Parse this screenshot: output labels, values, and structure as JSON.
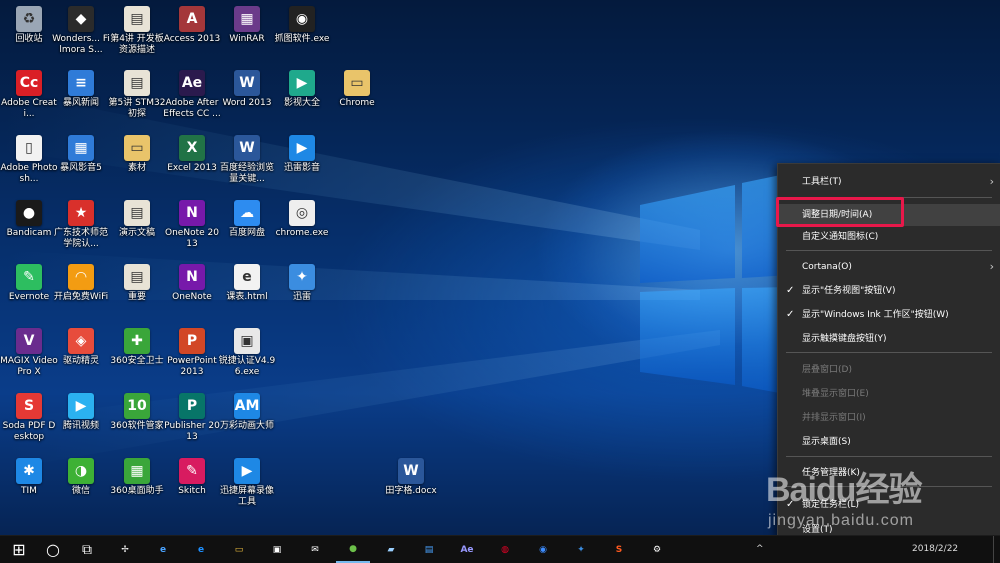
{
  "desktop_icons": [
    {
      "label": "回收站",
      "icon": "recycle-bin-icon",
      "color": "#9aa6b5",
      "glyph": "♻"
    },
    {
      "label": "Wonders... Filmora S...",
      "icon": "filmora-icon",
      "color": "#2b2b2b",
      "glyph": "◆"
    },
    {
      "label": "第4讲 开发板资源描述",
      "icon": "folder-file-icon",
      "color": "#e8e3d6",
      "glyph": "▤"
    },
    {
      "label": "Access 2013",
      "icon": "access-icon",
      "color": "#a4373a",
      "glyph": "A"
    },
    {
      "label": "WinRAR",
      "icon": "winrar-icon",
      "color": "#6b3b8a",
      "glyph": "▦"
    },
    {
      "label": "抓图软件.exe",
      "icon": "camera-icon",
      "color": "#222222",
      "glyph": "◉"
    },
    {
      "label": "Adobe Creati...",
      "icon": "adobe-cc-icon",
      "color": "#da1f26",
      "glyph": "Cc"
    },
    {
      "label": "暴风新闻",
      "icon": "news-icon",
      "color": "#2f7bd8",
      "glyph": "≡"
    },
    {
      "label": "第5讲 STM32初探",
      "icon": "folder-file-icon",
      "color": "#e8e3d6",
      "glyph": "▤"
    },
    {
      "label": "Adobe After Effects CC ...",
      "icon": "after-effects-icon",
      "color": "#2b1a4d",
      "glyph": "Ae"
    },
    {
      "label": "Word 2013",
      "icon": "word-icon",
      "color": "#2b579a",
      "glyph": "W"
    },
    {
      "label": "影视大全",
      "icon": "video-app-icon",
      "color": "#1fa98c",
      "glyph": "▶"
    },
    {
      "label": "Chrome",
      "icon": "folder-icon",
      "color": "#e9c46a",
      "glyph": "▭"
    },
    {
      "label": "Adobe Photosh...",
      "icon": "file-icon",
      "color": "#f2f2f2",
      "glyph": "▯"
    },
    {
      "label": "暴风影音5",
      "icon": "player-icon",
      "color": "#2f7bd8",
      "glyph": "▦"
    },
    {
      "label": "素材",
      "icon": "folder-icon",
      "color": "#e9c46a",
      "glyph": "▭"
    },
    {
      "label": "Excel 2013",
      "icon": "excel-icon",
      "color": "#217346",
      "glyph": "X"
    },
    {
      "label": "百度经验浏览量关键...",
      "icon": "word-icon",
      "color": "#2b579a",
      "glyph": "W"
    },
    {
      "label": "迅雷影音",
      "icon": "xunlei-player-icon",
      "color": "#1e88e5",
      "glyph": "▶"
    },
    {
      "label": "Bandicam",
      "icon": "bandicam-icon",
      "color": "#1a1a1a",
      "glyph": "●"
    },
    {
      "label": "广东技术师范学院认...",
      "icon": "shortcut-icon",
      "color": "#d9302b",
      "glyph": "★"
    },
    {
      "label": "演示文稿",
      "icon": "folder-file-icon",
      "color": "#e8e3d6",
      "glyph": "▤"
    },
    {
      "label": "OneNote 2013",
      "icon": "onenote-icon",
      "color": "#7719aa",
      "glyph": "N"
    },
    {
      "label": "百度网盘",
      "icon": "baidu-netdisk-icon",
      "color": "#2d8cf0",
      "glyph": "☁"
    },
    {
      "label": "chrome.exe",
      "icon": "chrome-icon",
      "color": "#eeeeee",
      "glyph": "◎"
    },
    {
      "label": "Evernote",
      "icon": "evernote-icon",
      "color": "#2dbe60",
      "glyph": "✎"
    },
    {
      "label": "开启免费WiFi",
      "icon": "wifi-icon",
      "color": "#f39c12",
      "glyph": "◠"
    },
    {
      "label": "重要",
      "icon": "folder-file-icon",
      "color": "#e8e3d6",
      "glyph": "▤"
    },
    {
      "label": "OneNote",
      "icon": "onenote-icon",
      "color": "#7719aa",
      "glyph": "N"
    },
    {
      "label": "课表.html",
      "icon": "html-file-icon",
      "color": "#f2f2f2",
      "glyph": "e"
    },
    {
      "label": "迅雷",
      "icon": "xunlei-icon",
      "color": "#3b8de0",
      "glyph": "✦"
    },
    {
      "label": "MAGIX Video Pro X",
      "icon": "magix-icon",
      "color": "#6a2c8e",
      "glyph": "V"
    },
    {
      "label": "驱动精灵",
      "icon": "driver-icon",
      "color": "#e74c3c",
      "glyph": "◈"
    },
    {
      "label": "360安全卫士",
      "icon": "360-security-icon",
      "color": "#3aa63a",
      "glyph": "✚"
    },
    {
      "label": "PowerPoint 2013",
      "icon": "powerpoint-icon",
      "color": "#d24726",
      "glyph": "P"
    },
    {
      "label": "锐捷认证V4.96.exe",
      "icon": "exe-icon",
      "color": "#e8e8e8",
      "glyph": "▣"
    },
    {
      "label": "Soda PDF Desktop",
      "icon": "soda-pdf-icon",
      "color": "#e53935",
      "glyph": "S"
    },
    {
      "label": "腾讯视频",
      "icon": "tencent-video-icon",
      "color": "#2bb1f0",
      "glyph": "▶"
    },
    {
      "label": "360软件管家",
      "icon": "360-software-icon",
      "color": "#3aa63a",
      "glyph": "10"
    },
    {
      "label": "Publisher 2013",
      "icon": "publisher-icon",
      "color": "#077568",
      "glyph": "P"
    },
    {
      "label": "万彩动画大师",
      "icon": "animation-icon",
      "color": "#1e88e5",
      "glyph": "AM"
    },
    {
      "label": "TIM",
      "icon": "tim-icon",
      "color": "#1e88e5",
      "glyph": "✱"
    },
    {
      "label": "微信",
      "icon": "wechat-icon",
      "color": "#3eb135",
      "glyph": "◑"
    },
    {
      "label": "360桌面助手",
      "icon": "360-desktop-icon",
      "color": "#3aa63a",
      "glyph": "▦"
    },
    {
      "label": "Skitch",
      "icon": "skitch-icon",
      "color": "#d81b60",
      "glyph": "✎"
    },
    {
      "label": "迅捷屏幕录像工具",
      "icon": "screen-recorder-icon",
      "color": "#1e88e5",
      "glyph": "▶"
    },
    {
      "label": "田字格.docx",
      "icon": "word-icon",
      "color": "#2b579a",
      "glyph": "W"
    }
  ],
  "context_menu": {
    "items": [
      {
        "label": "工具栏(T)",
        "submenu": true
      },
      {
        "label": "调整日期/时间(A)",
        "highlight": true
      },
      {
        "label": "自定义通知图标(C)"
      },
      {
        "label": "Cortana(O)",
        "submenu": true
      },
      {
        "label": "显示\"任务视图\"按钮(V)",
        "checked": true
      },
      {
        "label": "显示\"Windows Ink 工作区\"按钮(W)",
        "checked": true
      },
      {
        "label": "显示触摸键盘按钮(Y)"
      },
      {
        "label": "层叠窗口(D)",
        "disabled": true
      },
      {
        "label": "堆叠显示窗口(E)",
        "disabled": true
      },
      {
        "label": "并排显示窗口(I)",
        "disabled": true
      },
      {
        "label": "显示桌面(S)"
      },
      {
        "label": "任务管理器(K)"
      },
      {
        "label": "锁定任务栏(L)",
        "checked": true
      },
      {
        "label": "设置(T)"
      }
    ]
  },
  "taskbar": {
    "start_icon": "⊞",
    "search_icon": "○",
    "taskview_icon": "⧉",
    "apps": [
      {
        "name": "fan-app-icon",
        "glyph": "✢",
        "color": "#ffffff"
      },
      {
        "name": "ie-icon",
        "glyph": "e",
        "color": "#4aa3ff"
      },
      {
        "name": "edge-icon",
        "glyph": "e",
        "color": "#1e90ff"
      },
      {
        "name": "file-explorer-icon",
        "glyph": "▭",
        "color": "#f0c040"
      },
      {
        "name": "store-icon",
        "glyph": "▣",
        "color": "#ffffff"
      },
      {
        "name": "mail-icon",
        "glyph": "✉",
        "color": "#ffffff"
      },
      {
        "name": "green-app-icon",
        "glyph": "●",
        "color": "#6cc04a",
        "active": true
      },
      {
        "name": "laptop-app-icon",
        "glyph": "▰",
        "color": "#9ad0ff"
      },
      {
        "name": "screen-app-icon",
        "glyph": "▤",
        "color": "#4aa3ff"
      },
      {
        "name": "after-effects-icon",
        "glyph": "Ae",
        "color": "#9999ff"
      },
      {
        "name": "netease-music-icon",
        "glyph": "◍",
        "color": "#e60026"
      },
      {
        "name": "browser-app-icon",
        "glyph": "◉",
        "color": "#3c8cff"
      },
      {
        "name": "xunlei-icon",
        "glyph": "✦",
        "color": "#3b8de0"
      },
      {
        "name": "sogou-icon",
        "glyph": "S",
        "color": "#ff5a1f"
      },
      {
        "name": "settings-icon",
        "glyph": "⚙",
        "color": "#ffffff"
      }
    ],
    "tray_date": "2018/2/22",
    "tray_chevron": "^"
  },
  "watermark": {
    "line1": "Baidu经验",
    "line2": "jingyan.baidu.com"
  }
}
